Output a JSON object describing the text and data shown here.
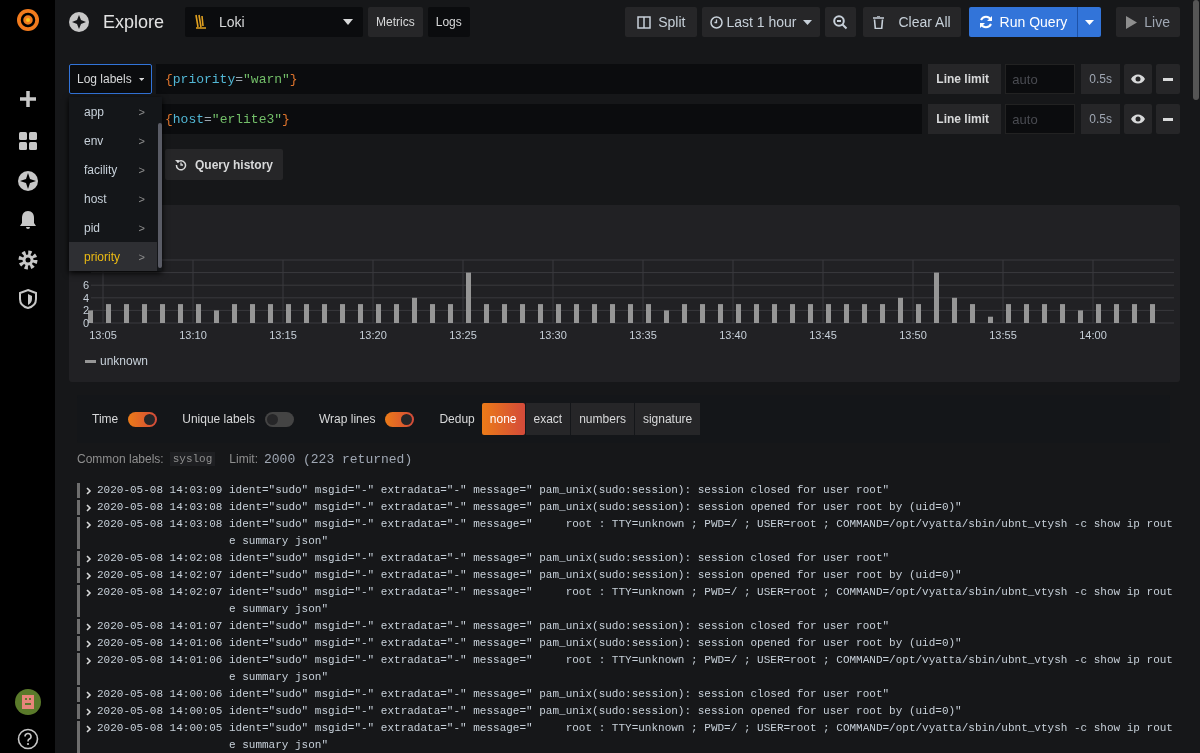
{
  "toolbar": {
    "title": "Explore",
    "datasource": "Loki",
    "modes": [
      {
        "label": "Metrics",
        "selected": false
      },
      {
        "label": "Logs",
        "selected": true
      }
    ],
    "split": "Split",
    "time_range": "Last 1 hour",
    "clear": "Clear All",
    "run": "Run Query",
    "live": "Live"
  },
  "queries": [
    {
      "label_button": "Log labels",
      "tokens": [
        {
          "kind": "brace",
          "text": "{"
        },
        {
          "kind": "key",
          "text": "priority"
        },
        {
          "kind": "op",
          "text": "="
        },
        {
          "kind": "string",
          "text": "\"warn\""
        },
        {
          "kind": "brace",
          "text": "}"
        }
      ],
      "line_limit_label": "Line limit",
      "line_limit_placeholder": "auto",
      "duration": "0.5s"
    },
    {
      "tokens": [
        {
          "kind": "brace",
          "text": "{"
        },
        {
          "kind": "key",
          "text": "host"
        },
        {
          "kind": "op",
          "text": "="
        },
        {
          "kind": "string",
          "text": "\"erlite3\""
        },
        {
          "kind": "brace",
          "text": "}"
        }
      ],
      "line_limit_label": "Line limit",
      "line_limit_placeholder": "auto",
      "duration": "0.5s"
    }
  ],
  "label_menu": {
    "items": [
      {
        "label": "app",
        "chevron": ">",
        "selected": false
      },
      {
        "label": "env",
        "chevron": ">",
        "selected": false
      },
      {
        "label": "facility",
        "chevron": ">",
        "selected": false
      },
      {
        "label": "host",
        "chevron": ">",
        "selected": false
      },
      {
        "label": "pid",
        "chevron": ">",
        "selected": false
      },
      {
        "label": "priority",
        "chevron": ">",
        "selected": true
      }
    ]
  },
  "query_history": "Query history",
  "chart": {
    "chart_data": {
      "type": "bar",
      "grid": true,
      "categories": [
        null,
        "13:05",
        null,
        null,
        null,
        null,
        "13:10",
        null,
        null,
        null,
        null,
        "13:15",
        null,
        null,
        null,
        null,
        "13:20",
        null,
        null,
        null,
        null,
        "13:25",
        null,
        null,
        null,
        null,
        "13:30",
        null,
        null,
        null,
        null,
        "13:35",
        null,
        null,
        null,
        null,
        "13:40",
        null,
        null,
        null,
        null,
        "13:45",
        null,
        null,
        null,
        null,
        "13:50",
        null,
        null,
        null,
        null,
        "13:55",
        null,
        null,
        null,
        null,
        "14:00",
        null,
        null,
        null
      ],
      "series": [
        {
          "name": "unknown",
          "color": "#969696",
          "values": [
            2,
            3,
            3,
            3,
            3,
            3,
            3,
            2,
            3,
            3,
            3,
            3,
            3,
            3,
            3,
            3,
            3,
            3,
            4,
            3,
            3,
            8,
            3,
            3,
            3,
            3,
            3,
            3,
            3,
            3,
            3,
            3,
            2,
            3,
            3,
            3,
            3,
            3,
            3,
            3,
            3,
            3,
            3,
            3,
            3,
            4,
            3,
            8,
            4,
            3,
            1,
            3,
            3,
            3,
            3,
            2,
            3,
            3,
            3,
            3
          ]
        }
      ],
      "ylim": [
        0,
        10
      ],
      "yticks": [
        0,
        2,
        4,
        6
      ]
    }
  },
  "options": {
    "toggles": [
      {
        "label": "Time",
        "on": true
      },
      {
        "label": "Unique labels",
        "on": false
      },
      {
        "label": "Wrap lines",
        "on": true
      }
    ],
    "dedup_label": "Dedup",
    "dedup": [
      {
        "label": "none",
        "selected": true
      },
      {
        "label": "exact",
        "selected": false
      },
      {
        "label": "numbers",
        "selected": false
      },
      {
        "label": "signature",
        "selected": false
      }
    ]
  },
  "common_labels": {
    "label": "Common labels:",
    "values": [
      "syslog"
    ]
  },
  "limit": {
    "label": "Limit:",
    "value": "2000 (223 returned)"
  },
  "logs": [
    {
      "time": "2020-05-08 14:03:09",
      "message": "ident=\"sudo\" msgid=\"-\" extradata=\"-\" message=\" pam_unix(sudo:session): session closed for user root\""
    },
    {
      "time": "2020-05-08 14:03:08",
      "message": "ident=\"sudo\" msgid=\"-\" extradata=\"-\" message=\" pam_unix(sudo:session): session opened for user root by (uid=0)\""
    },
    {
      "time": "2020-05-08 14:03:08",
      "message": "ident=\"sudo\" msgid=\"-\" extradata=\"-\" message=\"     root : TTY=unknown ; PWD=/ ; USER=root ; COMMAND=/opt/vyatta/sbin/ubnt_vtysh -c show ip route summary json\""
    },
    {
      "time": "2020-05-08 14:02:08",
      "message": "ident=\"sudo\" msgid=\"-\" extradata=\"-\" message=\" pam_unix(sudo:session): session closed for user root\""
    },
    {
      "time": "2020-05-08 14:02:07",
      "message": "ident=\"sudo\" msgid=\"-\" extradata=\"-\" message=\" pam_unix(sudo:session): session opened for user root by (uid=0)\""
    },
    {
      "time": "2020-05-08 14:02:07",
      "message": "ident=\"sudo\" msgid=\"-\" extradata=\"-\" message=\"     root : TTY=unknown ; PWD=/ ; USER=root ; COMMAND=/opt/vyatta/sbin/ubnt_vtysh -c show ip route summary json\""
    },
    {
      "time": "2020-05-08 14:01:07",
      "message": "ident=\"sudo\" msgid=\"-\" extradata=\"-\" message=\" pam_unix(sudo:session): session closed for user root\""
    },
    {
      "time": "2020-05-08 14:01:06",
      "message": "ident=\"sudo\" msgid=\"-\" extradata=\"-\" message=\" pam_unix(sudo:session): session opened for user root by (uid=0)\""
    },
    {
      "time": "2020-05-08 14:01:06",
      "message": "ident=\"sudo\" msgid=\"-\" extradata=\"-\" message=\"     root : TTY=unknown ; PWD=/ ; USER=root ; COMMAND=/opt/vyatta/sbin/ubnt_vtysh -c show ip route summary json\""
    },
    {
      "time": "2020-05-08 14:00:06",
      "message": "ident=\"sudo\" msgid=\"-\" extradata=\"-\" message=\" pam_unix(sudo:session): session closed for user root\""
    },
    {
      "time": "2020-05-08 14:00:05",
      "message": "ident=\"sudo\" msgid=\"-\" extradata=\"-\" message=\" pam_unix(sudo:session): session opened for user root by (uid=0)\""
    },
    {
      "time": "2020-05-08 14:00:05",
      "message": "ident=\"sudo\" msgid=\"-\" extradata=\"-\" message=\"     root : TTY=unknown ; PWD=/ ; USER=root ; COMMAND=/opt/vyatta/sbin/ubnt_vtysh -c show ip route summary json\""
    }
  ]
}
